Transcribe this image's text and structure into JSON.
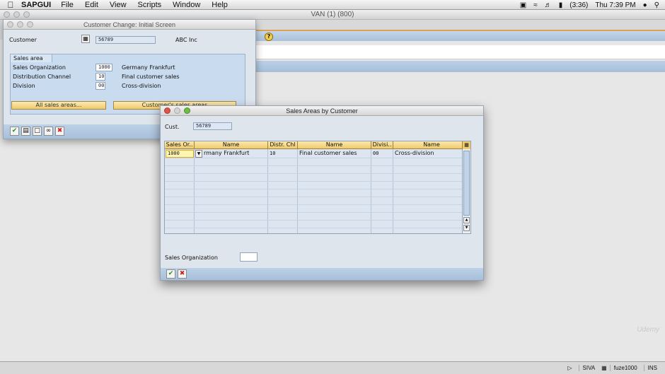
{
  "menubar": {
    "app_name": "SAPGUI",
    "menus": [
      "File",
      "Edit",
      "View",
      "Scripts",
      "Window",
      "Help"
    ],
    "battery": "(3:36)",
    "clock": "Thu 7:39 PM"
  },
  "main_window": {
    "title": "VAN (1) (800)"
  },
  "customer_change": {
    "title": "Customer Change: Initial Screen",
    "customer_label": "Customer",
    "customer_value": "56789",
    "customer_name": "ABC Inc",
    "sales_area_title": "Sales area",
    "rows": [
      {
        "label": "Sales Organization",
        "value": "1000",
        "desc": "Germany Frankfurt"
      },
      {
        "label": "Distribution Channel",
        "value": "10",
        "desc": "Final customer sales"
      },
      {
        "label": "Division",
        "value": "00",
        "desc": "Cross-division"
      }
    ],
    "btn_all_sales_areas": "All sales areas...",
    "btn_customer_sales_areas": "Customer's sales areas"
  },
  "popup": {
    "title": "Sales Areas by Customer",
    "cust_label": "Cust.",
    "cust_value": "56789",
    "columns": [
      "Sales Or..",
      "Name",
      "Distr. Chl",
      "Name",
      "Divisi..",
      "Name"
    ],
    "row": {
      "sales_org": "1000",
      "sales_org_name": "rmany Frankfurt",
      "distr_chl": "10",
      "distr_name": "Final customer sales",
      "division": "00",
      "division_name": "Cross-division"
    },
    "sales_org_label": "Sales Organization",
    "sales_org_value": ""
  },
  "statusbar": {
    "user": "SIVA",
    "server": "fuze1000",
    "mode": "INS"
  },
  "watermark": "Udemy",
  "colors": {
    "sap_blue": "#a9c1db",
    "button_gold": "#f0c96b",
    "selected_cell": "#fff5b0"
  }
}
